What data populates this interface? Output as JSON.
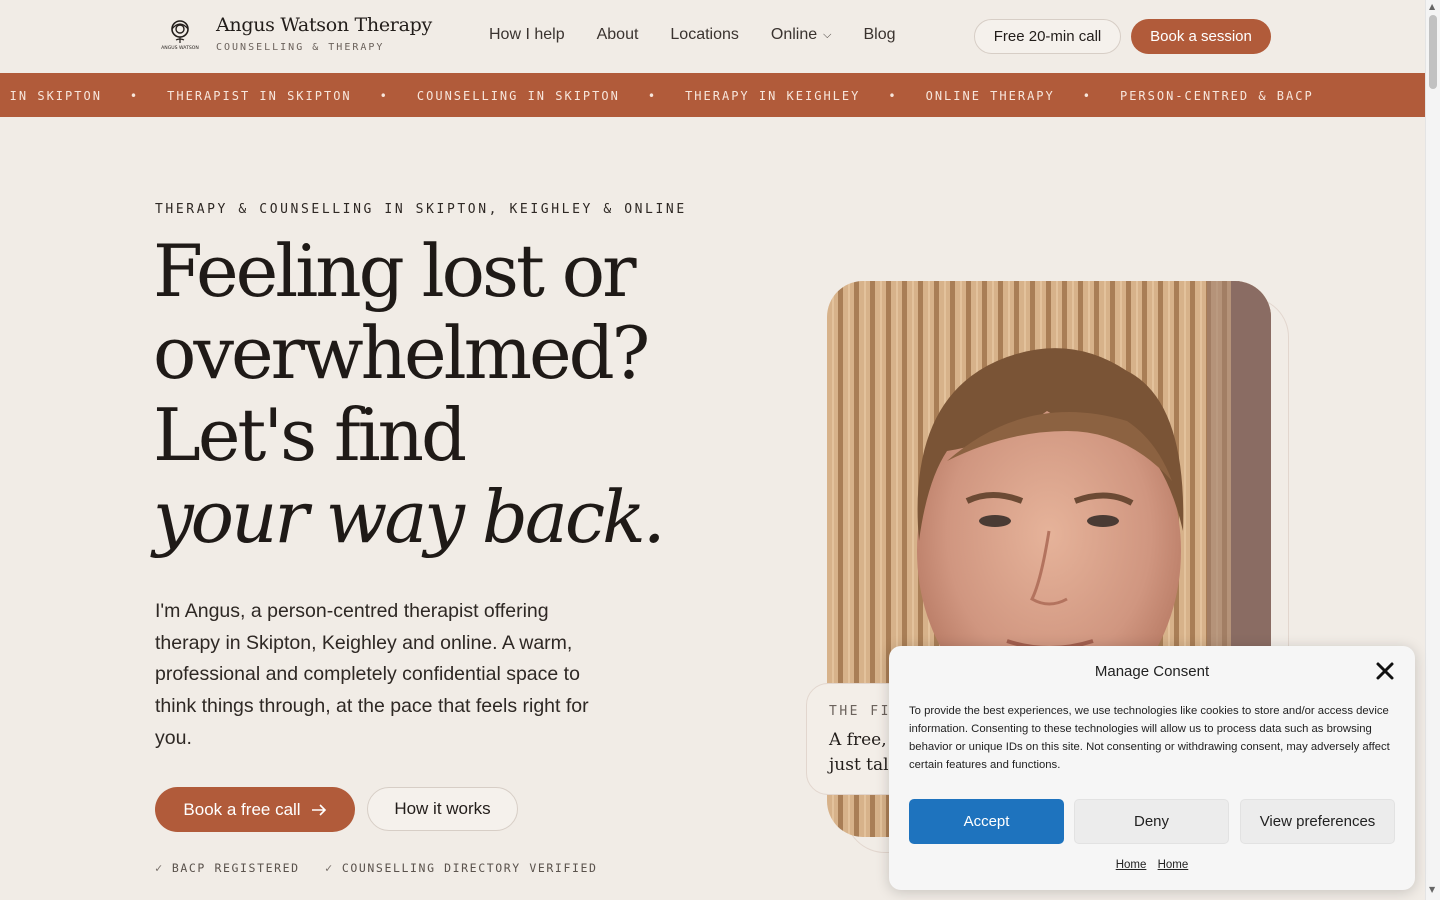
{
  "header": {
    "brand_title": "Angus Watson Therapy",
    "brand_subtitle": "COUNSELLING & THERAPY",
    "logo_text": "ANGUS WATSON",
    "nav": [
      {
        "label": "How I help"
      },
      {
        "label": "About"
      },
      {
        "label": "Locations"
      },
      {
        "label": "Online",
        "has_dropdown": true
      },
      {
        "label": "Blog"
      }
    ],
    "free_call_label": "Free 20-min call",
    "book_label": "Book a session"
  },
  "marquee": {
    "items": [
      "THERAPY IN SKIPTON",
      "THERAPIST IN SKIPTON",
      "COUNSELLING IN SKIPTON",
      "THERAPY IN KEIGHLEY",
      "ONLINE THERAPY",
      "PERSON-CENTRED & BACP"
    ],
    "first_visible_fragment": "PY IN SKIPTON",
    "separator": "•"
  },
  "hero": {
    "eyebrow": "THERAPY & COUNSELLING IN SKIPTON, KEIGHLEY & ONLINE",
    "headline_lines": [
      "Feeling lost or",
      "overwhelmed?",
      "Let's find"
    ],
    "headline_italic": "your way back.",
    "lede": "I'm Angus, a person-centred therapist offering therapy in Skipton, Keighley and online. A warm, professional and completely confidential space to think things through, at the pace that feels right for you.",
    "cta_primary": "Book a free call",
    "cta_secondary": "How it works",
    "trust": [
      "BACP REGISTERED",
      "COUNSELLING DIRECTORY VERIFIED"
    ]
  },
  "quote_card": {
    "label": "THE FI",
    "line1": "A free, n",
    "line2": "just talk,"
  },
  "consent": {
    "title": "Manage Consent",
    "body": "To provide the best experiences, we use technologies like cookies to store and/or access device information. Consenting to these technologies will allow us to process data such as browsing behavior or unique IDs on this site. Not consenting or withdrawing consent, may adversely affect certain features and functions.",
    "accept": "Accept",
    "deny": "Deny",
    "preferences": "View preferences",
    "links": [
      "Home",
      "Home"
    ]
  },
  "colors": {
    "accent": "#b15b3a",
    "background": "#f1ece6",
    "consent_accept": "#1e73be"
  }
}
